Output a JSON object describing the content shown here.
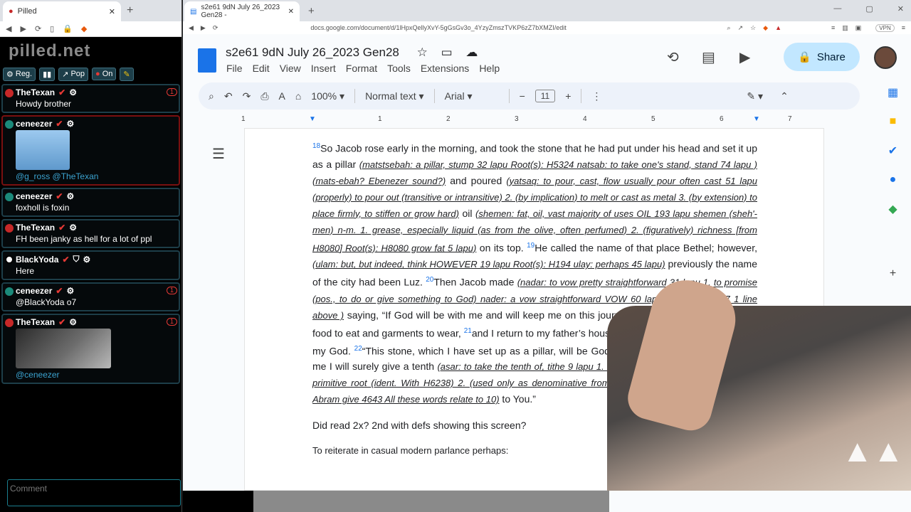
{
  "left_browser": {
    "tab_title": "Pilled"
  },
  "chat": {
    "brand": "pilled.net",
    "toolbar": {
      "reg": "Reg.",
      "pop": "Pop",
      "on": "On"
    },
    "messages": [
      {
        "user": "TheTexan",
        "text": "Howdy brother",
        "badge": "1"
      },
      {
        "user": "ceneezer",
        "text": "@g_ross @TheTexan"
      },
      {
        "user": "ceneezer",
        "text": "foxholl is foxin"
      },
      {
        "user": "TheTexan",
        "text": "FH been janky as hell for a lot of ppl"
      },
      {
        "user": "BlackYoda",
        "text": "Here"
      },
      {
        "user": "ceneezer",
        "text": "@BlackYoda o7",
        "badge": "1"
      },
      {
        "user": "TheTexan",
        "text": "@ceneezer",
        "badge": "1"
      }
    ],
    "comment_placeholder": "Comment"
  },
  "browser": {
    "tab_title": "s2e61 9dN July 26_2023 Gen28 -",
    "url": "docs.google.com/document/d/1lHpxQellyXvY-5gGsGv3o_4YzyZmszTVKP6zZ7bXMZI/edit",
    "vpn": "VPN"
  },
  "doc": {
    "title": "s2e61 9dN July 26_2023 Gen28",
    "menu": [
      "File",
      "Edit",
      "View",
      "Insert",
      "Format",
      "Tools",
      "Extensions",
      "Help"
    ],
    "zoom": "100%",
    "style": "Normal text",
    "font": "Arial",
    "font_size": "11",
    "share": "Share",
    "ruler": [
      "1",
      "1",
      "2",
      "3",
      "4",
      "5",
      "6",
      "7"
    ],
    "v18": "18",
    "p1a": "So Jacob rose early in the morning, and took the stone that he had put under his head and set it up as a pillar ",
    "d1": "(matstsebah: a pillar, stump 32 lapu Root(s): H5324 natsab: to take one's stand, stand 74 lapu ) (mats-ebah? Ebenezer sound?)",
    "p1b": " and poured ",
    "d2": "(yatsaq: to pour, cast, flow usually pour often cast 51 lapu (properly) to pour out (transitive or intransitive) 2. (by implication) to melt or cast as metal 3. (by extension) to place firmly, to stiffen or grow hard)",
    "p1c": " oil ",
    "d3": "(shemen: fat, oil, vast majority of uses OIL 193 lapu shemen (sheh'-men) n-m. 1. grease, especially liquid (as from the olive, often perfumed) 2. (figuratively) richness [from H8080] Root(s): H8080 grow fat 5 lapu)",
    "p1d": " on its top. ",
    "v19": "19",
    "p1e": "He called the name of that place Bethel; however, ",
    "d4": "(ulam: but, but indeed, think HOWEVER 19 lapu Root(s): H194 ulay: perhaps 45 lapu)",
    "p1f": " previously the name of the city had been Luz. ",
    "v20": "20",
    "p1g": "Then Jacob made ",
    "d5": "(nadar: to vow pretty straightforward 31 lapu 1. to promise (pos., to do or give something to God) nader: a vow straightforward VOW 60 lapu Root(s): H5087 1 line above )",
    "p1h": " saying, “If God will be with me and will keep me on this journey that I take, and will give me food to eat and garments to wear, ",
    "v21": "21",
    "p1i": "and I return to my father’s house in safety, then the LORD will be my God. ",
    "v22": "22",
    "p1j": "“This stone, which I have set up as a pillar, will be God’s house, and of all that You give me I will surely give a tenth ",
    "d6": "(asar: to take the tenth of, tithe 9 lapu 1. to tithe, i.e. to take or give a tenth [a primitive root (ident. With H6238) 2. (used only as denominative from H6235] In Genesis 14:20 we saw Abram give 4643 All these words relate to 10)",
    "p1k": " to You.”",
    "q": "Did read 2x? 2nd with defs showing this screen?",
    "r": "To reiterate in casual modern parlance perhaps:"
  }
}
